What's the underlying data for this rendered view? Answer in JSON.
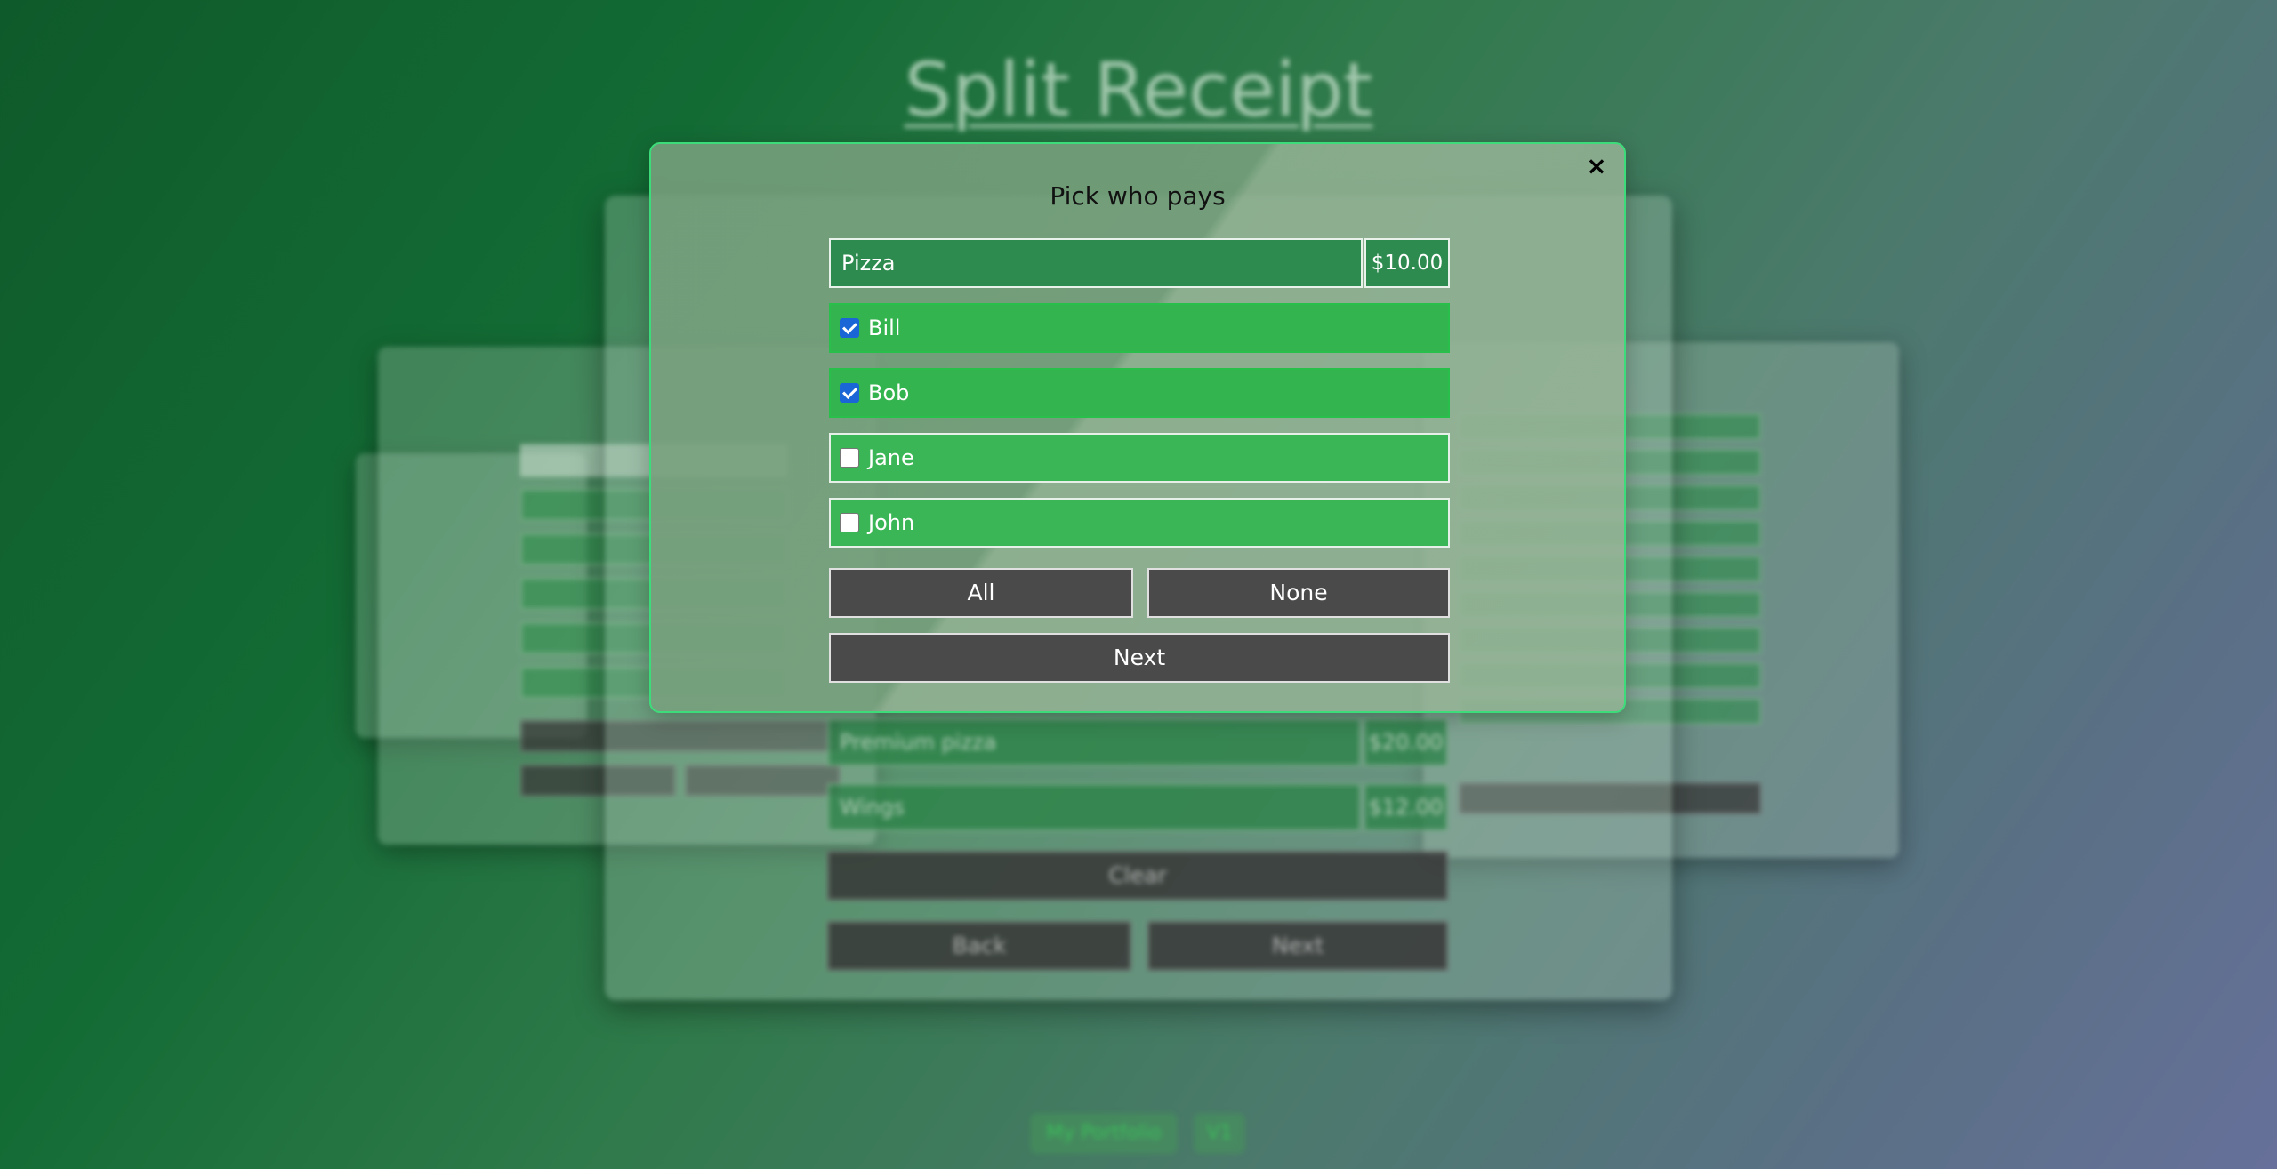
{
  "page": {
    "title": "Split Receipt"
  },
  "background": {
    "items": [
      {
        "name": "Premium pizza",
        "price": "$20.00"
      },
      {
        "name": "Wings",
        "price": "$12.00"
      }
    ],
    "clear_label": "Clear",
    "back_label": "Back",
    "next_label": "Next"
  },
  "footer": {
    "portfolio_label": "My Portfolio",
    "small_label": "V1"
  },
  "modal": {
    "title": "Pick who pays",
    "item_name": "Pizza",
    "item_price": "$10.00",
    "people": [
      {
        "name": "Bill",
        "checked": true
      },
      {
        "name": "Bob",
        "checked": true
      },
      {
        "name": "Jane",
        "checked": false
      },
      {
        "name": "John",
        "checked": false
      }
    ],
    "all_label": "All",
    "none_label": "None",
    "next_label": "Next",
    "close_icon": "×"
  },
  "colors": {
    "accent": "#3ddc7a",
    "checkbox": "#1a66d6",
    "person_row": "#3bb656",
    "button": "#4a4a4a"
  }
}
